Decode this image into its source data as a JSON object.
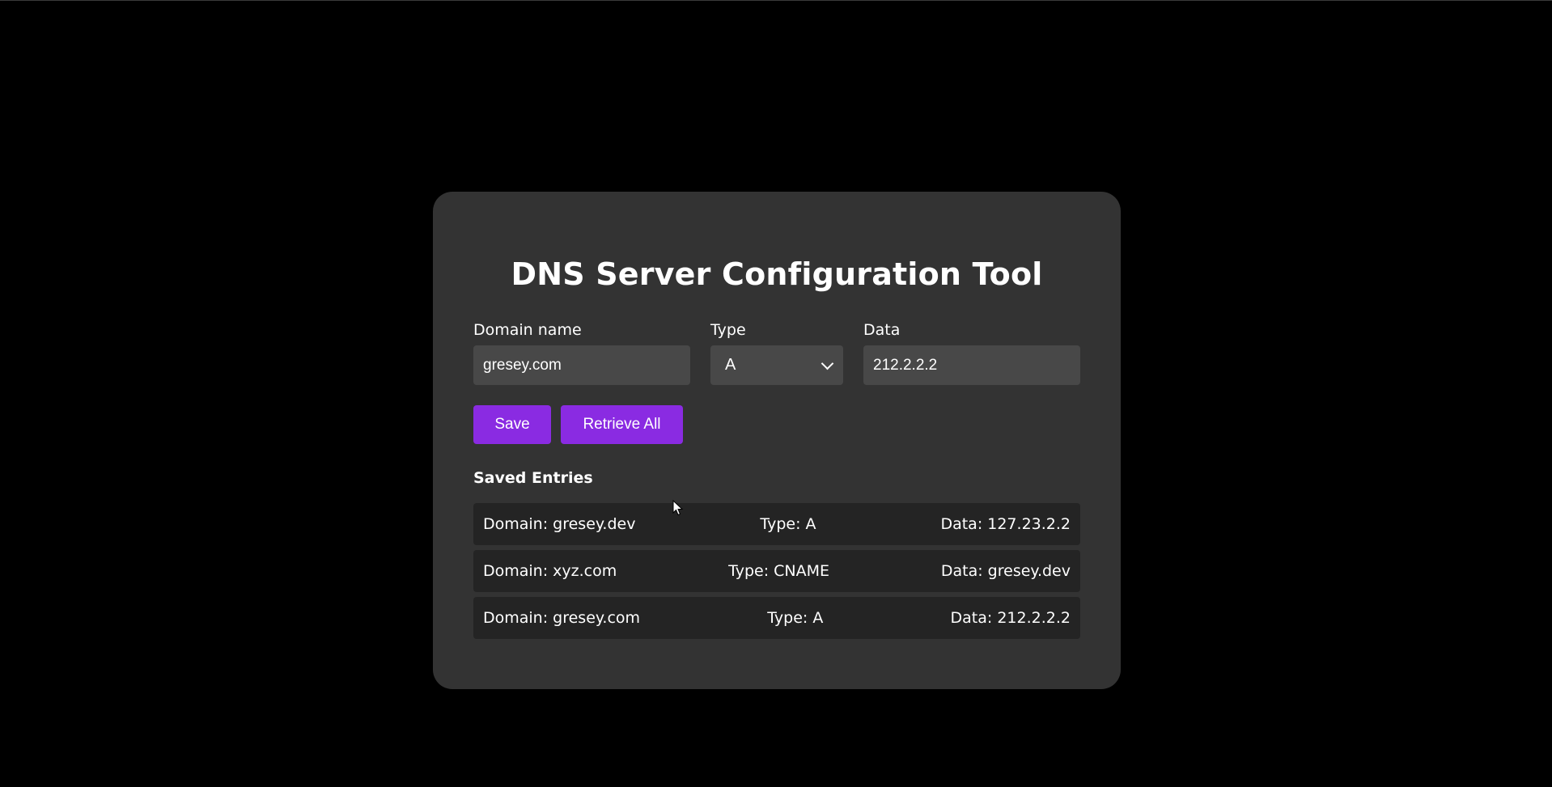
{
  "app": {
    "title": "DNS Server Configuration Tool"
  },
  "form": {
    "domain_label": "Domain name",
    "domain_value": "gresey.com",
    "type_label": "Type",
    "type_value": "A",
    "data_label": "Data",
    "data_value": "212.2.2.2",
    "save_label": "Save",
    "retrieve_label": "Retrieve All"
  },
  "saved": {
    "title": "Saved Entries",
    "entries": [
      {
        "domain": "Domain: gresey.dev",
        "type": "Type: A",
        "data": "Data: 127.23.2.2"
      },
      {
        "domain": "Domain: xyz.com",
        "type": "Type: CNAME",
        "data": "Data: gresey.dev"
      },
      {
        "domain": "Domain: gresey.com",
        "type": "Type: A",
        "data": "Data: 212.2.2.2"
      }
    ]
  },
  "colors": {
    "background": "#000000",
    "card": "#333333",
    "input": "#484848",
    "entry": "#242424",
    "accent": "#8a2be2"
  },
  "icons": {
    "select_arrow": "chevron-down-icon",
    "pointer": "mouse-cursor-icon"
  }
}
